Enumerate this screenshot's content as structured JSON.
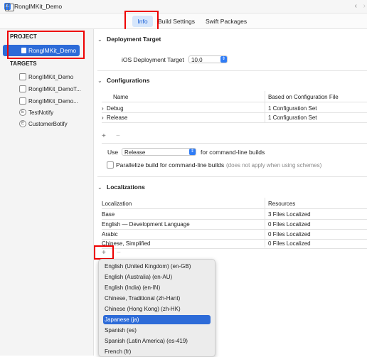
{
  "window": {
    "title": "RongIMKit_Demo"
  },
  "tabs": [
    "Info",
    "Build Settings",
    "Swift Packages"
  ],
  "sidebar": {
    "project_header": "PROJECT",
    "project_item": "RongIMKit_Demo",
    "targets_header": "TARGETS",
    "targets": [
      {
        "label": "RongIMKit_Demo",
        "icon": "app-icon"
      },
      {
        "label": "RongIMKit_DemoT...",
        "icon": "app-icon"
      },
      {
        "label": "RongIMKit_Demo...",
        "icon": "app-icon"
      },
      {
        "label": "TestNotify",
        "icon": "extension-icon",
        "glyph": "E"
      },
      {
        "label": "CustomerBotify",
        "icon": "extension-icon",
        "glyph": "E"
      }
    ]
  },
  "deployment": {
    "title": "Deployment Target",
    "label": "iOS Deployment Target",
    "value": "10.0"
  },
  "configurations": {
    "title": "Configurations",
    "col_name": "Name",
    "col_based": "Based on Configuration File",
    "rows": [
      {
        "name": "Debug",
        "based": "1 Configuration Set"
      },
      {
        "name": "Release",
        "based": "1 Configuration Set"
      }
    ],
    "use_label": "Use",
    "use_value": "Release",
    "use_suffix": "for command-line builds",
    "parallelize_label": "Parallelize build for command-line builds",
    "parallelize_hint": "(does not apply when using schemes)"
  },
  "localizations": {
    "title": "Localizations",
    "col_loc": "Localization",
    "col_res": "Resources",
    "rows": [
      {
        "name": "Base",
        "res": "3 Files Localized"
      },
      {
        "name": "English — Development Language",
        "res": "0 Files Localized"
      },
      {
        "name": "Arabic",
        "res": "0 Files Localized"
      },
      {
        "name": "Chinese, Simplified",
        "res": "0 Files Localized"
      }
    ]
  },
  "controls": {
    "plus": "+",
    "minus": "−"
  },
  "menu": {
    "items": [
      "English (United Kingdom) (en-GB)",
      "English (Australia) (en-AU)",
      "English (India) (en-IN)",
      "Chinese, Traditional (zh-Hant)",
      "Chinese (Hong Kong) (zh-HK)",
      "Japanese (ja)",
      "Spanish (es)",
      "Spanish (Latin America) (es-419)",
      "French (fr)"
    ],
    "selected_index": 5
  },
  "colors": {
    "accent": "#2d6bd8",
    "annotation": "#e00000"
  }
}
